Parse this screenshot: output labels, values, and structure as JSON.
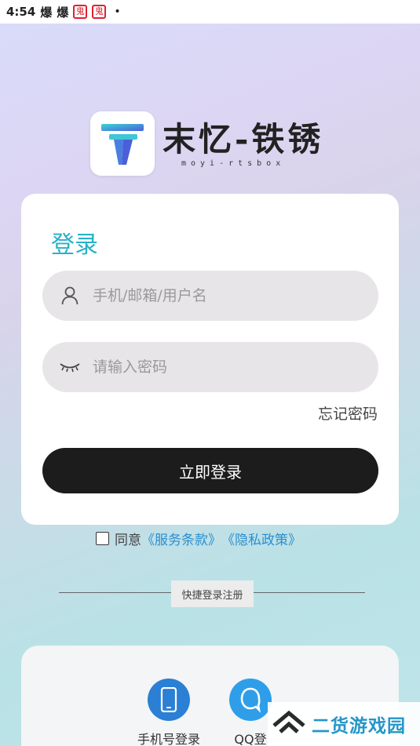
{
  "status_bar": {
    "time": "4:54",
    "notification_1": "爆",
    "notification_2": "爆",
    "app_icon_1": "鬼",
    "app_icon_2": "鬼",
    "dot": "•"
  },
  "brand": {
    "logo_letter": "T",
    "title": "末忆-铁锈",
    "subtitle": "moyi-rtsbox"
  },
  "login": {
    "title": "登录",
    "username_placeholder": "手机/邮箱/用户名",
    "password_placeholder": "请输入密码",
    "forgot_password": "忘记密码",
    "submit_label": "立即登录"
  },
  "agreement": {
    "agree_text": "同意",
    "terms_link": "《服务条款》",
    "privacy_link": "《隐私政策》"
  },
  "divider": {
    "label": "快捷登录注册"
  },
  "quick_login": {
    "phone_label": "手机号登录",
    "qq_label": "QQ登"
  },
  "watermark": {
    "text": "二货游戏园"
  },
  "colors": {
    "accent": "#2ab0c8",
    "button_bg": "#1c1c1c",
    "link": "#2a8fd0",
    "field_bg": "#e7e5e7"
  }
}
